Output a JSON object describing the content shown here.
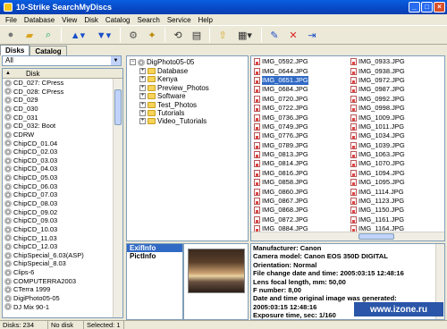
{
  "window": {
    "title": "10-Strike SearchMyDiscs"
  },
  "menu": [
    "File",
    "Database",
    "View",
    "Disk",
    "Catalog",
    "Search",
    "Service",
    "Help"
  ],
  "toolbar": {
    "buttons": [
      "back-icon",
      "open-folder-icon",
      "search-icon",
      "eject-icon",
      "load-icon",
      "settings-icon",
      "wizard-icon",
      "refresh-icon",
      "properties-icon",
      "up-folder-icon",
      "view-mode-icon",
      "edit-icon",
      "delete-icon",
      "exit-icon"
    ]
  },
  "left_panel": {
    "tabs": [
      "Disks",
      "Catalog"
    ],
    "filter": "All",
    "column_header": "Disk",
    "disks": [
      "CD_027: CPress",
      "CD_028: CPress",
      "CD_029",
      "CD_030",
      "CD_031",
      "CD_032: Boot",
      "CDRW",
      "ChipCD_01.04",
      "ChipCD_02.03",
      "ChipCD_03.03",
      "ChipCD_04.03",
      "ChipCD_05.03",
      "ChipCD_06.03",
      "ChipCD_07.03",
      "ChipCD_08.03",
      "ChipCD_09.02",
      "ChipCD_09.03",
      "ChipCD_10.03",
      "ChipCD_11.03",
      "ChipCD_12.03",
      "ChipSpecial_6.03(ASP)",
      "ChipSpecial_8.03",
      "Clips-6",
      "COMPUTERRA2003",
      "CTerra 1999",
      "DigiPhoto05-05",
      "DJ Mix 90-1"
    ]
  },
  "tree": {
    "root": "DigPhoto05-05",
    "folders": [
      "Database",
      "Kenya",
      "Preview_Photos",
      "Software",
      "Test_Photos",
      "Tutorials",
      "Video_Tutorials"
    ]
  },
  "files": {
    "col1": [
      "IMG_0592.JPG",
      "IMG_0644.JPG",
      "IMG_0651.JPG",
      "IMG_0684.JPG",
      "IMG_0720.JPG",
      "IMG_0722.JPG",
      "IMG_0736.JPG",
      "IMG_0749.JPG",
      "IMG_0776.JPG",
      "IMG_0789.JPG",
      "IMG_0813.JPG",
      "IMG_0814.JPG",
      "IMG_0816.JPG",
      "IMG_0858.JPG",
      "IMG_0860.JPG",
      "IMG_0867.JPG",
      "IMG_0868.JPG",
      "IMG_0872.JPG",
      "IMG_0884.JPG"
    ],
    "col2": [
      "IMG_0933.JPG",
      "IMG_0938.JPG",
      "IMG_0972.JPG",
      "IMG_0987.JPG",
      "IMG_0992.JPG",
      "IMG_0998.JPG",
      "IMG_1009.JPG",
      "IMG_1011.JPG",
      "IMG_1034.JPG",
      "IMG_1039.JPG",
      "IMG_1063.JPG",
      "IMG_1070.JPG",
      "IMG_1094.JPG",
      "IMG_1095.JPG",
      "IMG_1114.JPG",
      "IMG_1123.JPG",
      "IMG_1150.JPG",
      "IMG_1161.JPG",
      "IMG_1164.JPG"
    ],
    "selected": "IMG_0651.JPG"
  },
  "info_tabs": [
    "ExifInfo",
    "PictInfo"
  ],
  "exif": [
    "Manufacturer: Canon",
    "Camera model: Canon EOS 350D DIGITAL",
    "Orientation: Normal",
    "File change date and time: 2005:03:15 12:48:16",
    "Lens focal length, mm: 50,00",
    "F number: 8,00",
    "Date and time original image was generated:",
    "2005:03:15 12:48:16",
    "Exposure time, sec: 1/160"
  ],
  "status": {
    "disks": "Disks: 234",
    "disk": "No disk",
    "selected": "Selected: 1"
  },
  "watermark": "www.izone.ru"
}
